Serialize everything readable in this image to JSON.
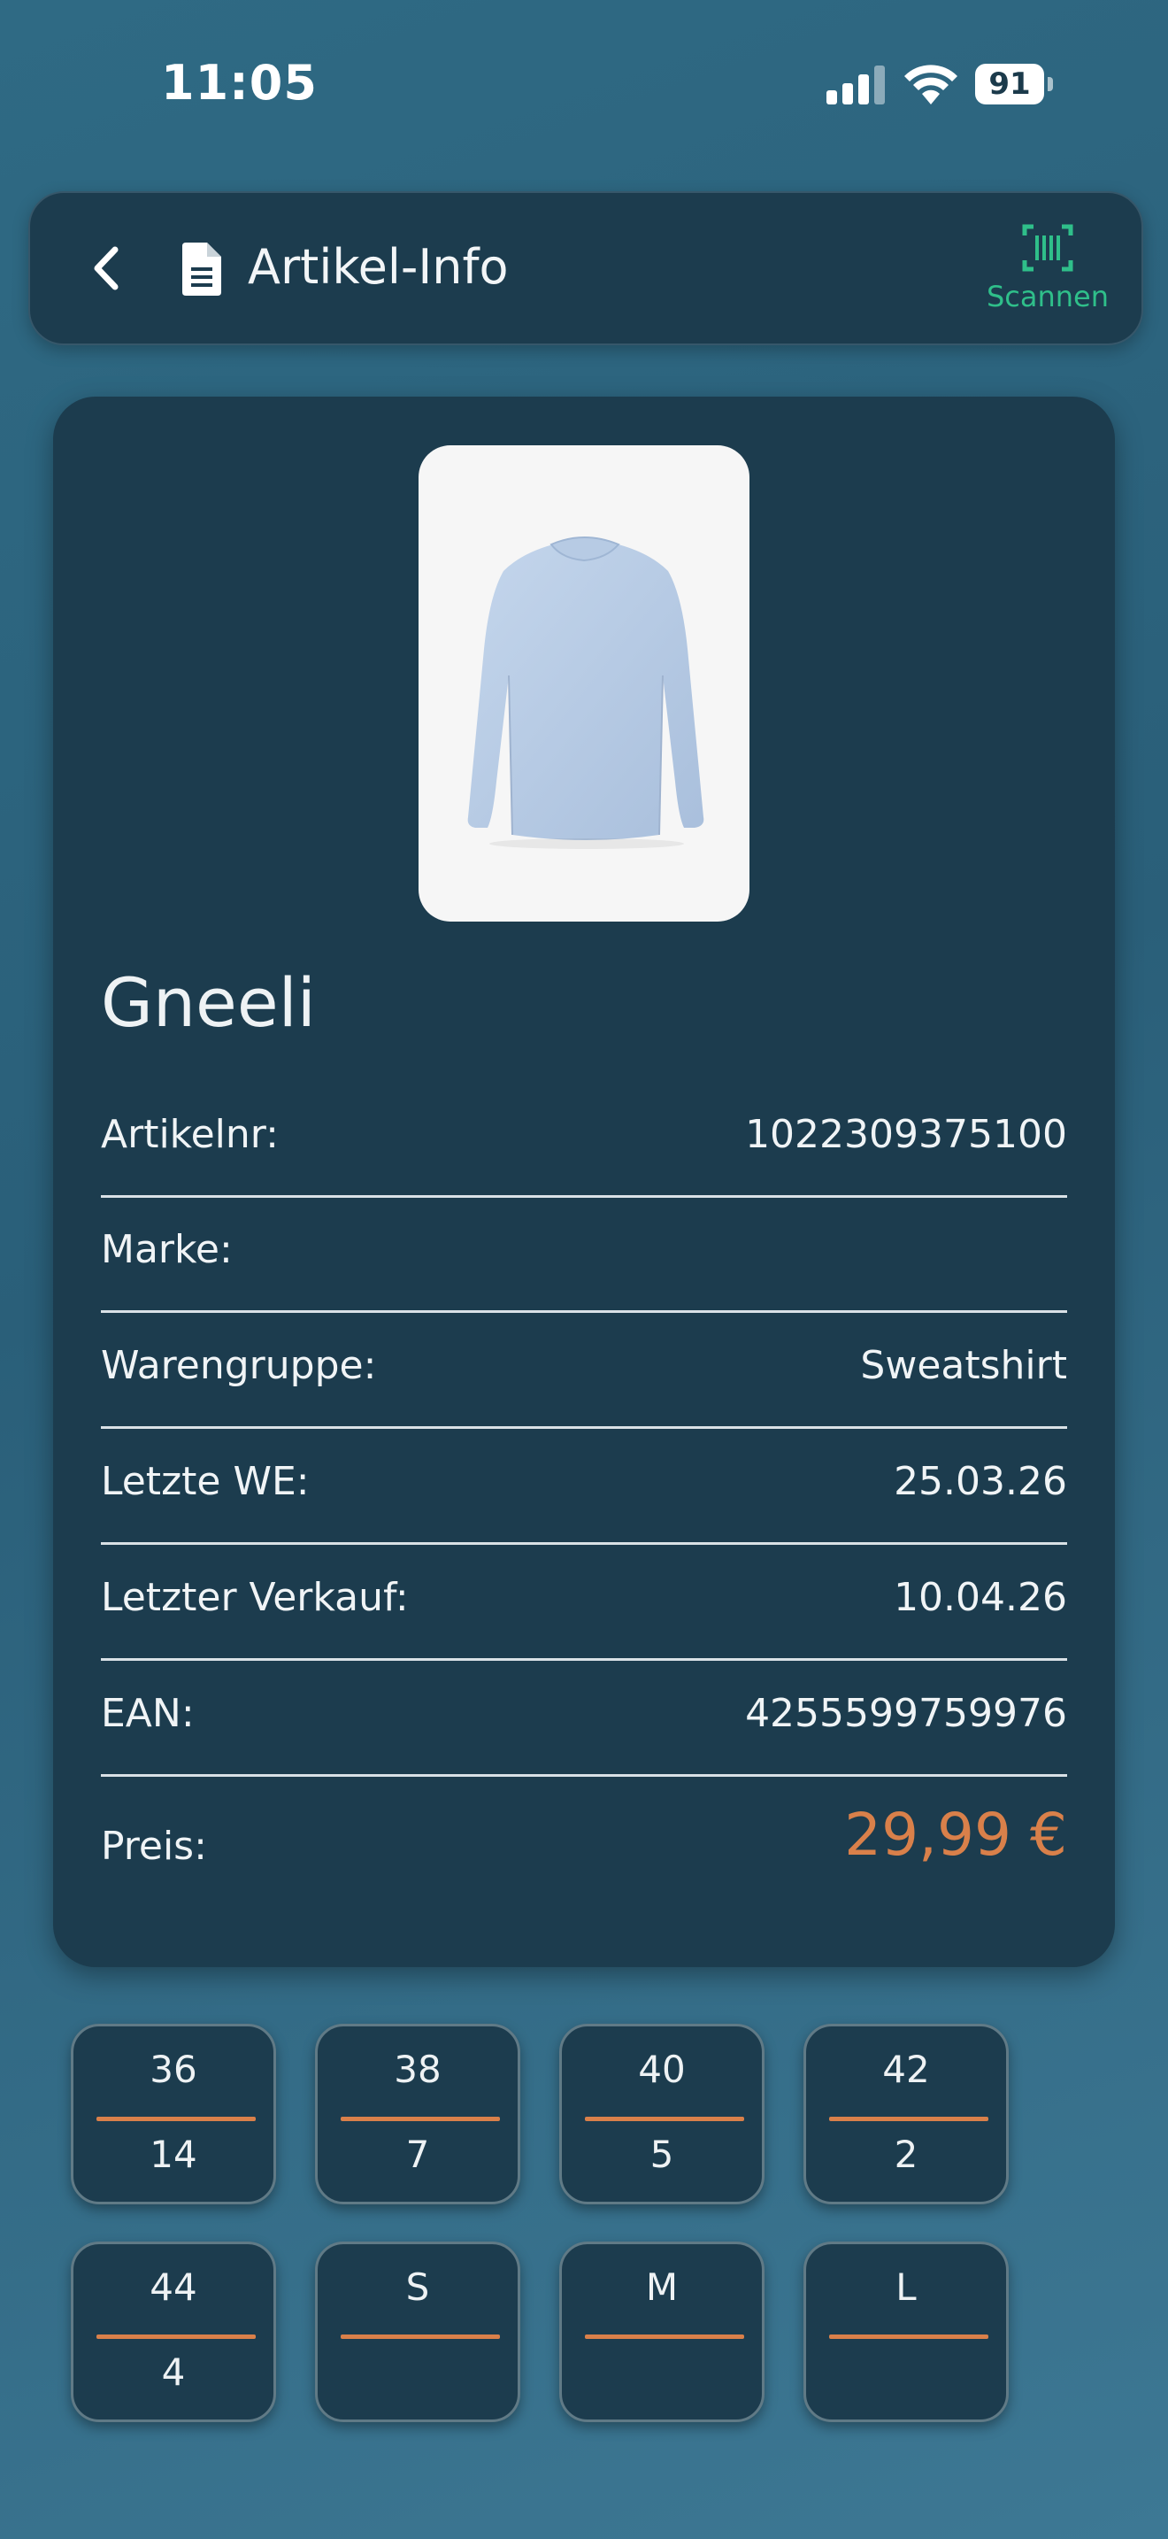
{
  "status_bar": {
    "time": "11:05",
    "battery": "91"
  },
  "header": {
    "title": "Artikel-Info",
    "scan_label": "Scannen"
  },
  "product": {
    "name": "Gneeli",
    "fields": [
      {
        "label": "Artikelnr:",
        "value": "1022309375100"
      },
      {
        "label": "Marke:",
        "value": ""
      },
      {
        "label": "Warengruppe:",
        "value": "Sweatshirt"
      },
      {
        "label": "Letzte WE:",
        "value": "25.03.26"
      },
      {
        "label": "Letzter Verkauf:",
        "value": "10.04.26"
      },
      {
        "label": "EAN:",
        "value": "4255599759976"
      }
    ],
    "price_label": "Preis:",
    "price": "29,99 €"
  },
  "sizes": [
    {
      "size": "36",
      "qty": "14"
    },
    {
      "size": "38",
      "qty": "7"
    },
    {
      "size": "40",
      "qty": "5"
    },
    {
      "size": "42",
      "qty": "2"
    },
    {
      "size": "44",
      "qty": "4"
    },
    {
      "size": "S",
      "qty": ""
    },
    {
      "size": "M",
      "qty": ""
    },
    {
      "size": "L",
      "qty": ""
    }
  ],
  "colors": {
    "accent_price": "#d9804a",
    "scan_green": "#2fbf8a",
    "card_bg": "#1c3c4e"
  }
}
